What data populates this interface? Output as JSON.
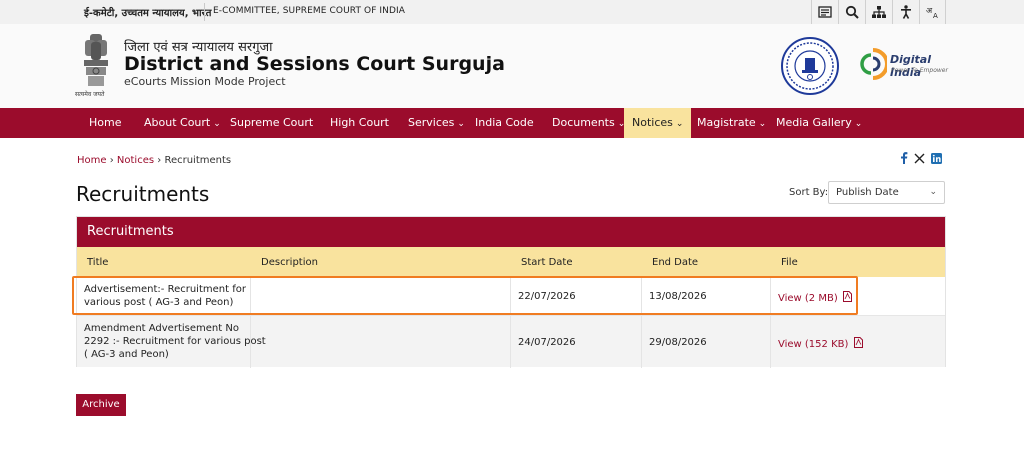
{
  "topbar": {
    "gov_label": "ई-कमेटी, उच्चतम न्यायालय, भारत",
    "ecommittee_label": "E-COMMITTEE, SUPREME COURT OF INDIA",
    "tools": [
      "sitemap-icon",
      "search-icon",
      "hierarchy-icon",
      "accessibility-icon",
      "language-icon"
    ]
  },
  "header": {
    "emblem_motto": "सत्यमेव जयते",
    "hindi_title": "जिला एवं सत्र न्यायालय सरगुजा",
    "title": "District and Sessions Court Surguja",
    "subtitle": "eCourts Mission Mode Project",
    "digital_india": "Digital India",
    "digital_india_tagline": "Power To Empower"
  },
  "nav": {
    "items": [
      {
        "label": "Home",
        "dropdown": false
      },
      {
        "label": "About Court",
        "dropdown": true
      },
      {
        "label": "Supreme Court",
        "dropdown": false
      },
      {
        "label": "High Court",
        "dropdown": false
      },
      {
        "label": "Services",
        "dropdown": true
      },
      {
        "label": "India Code",
        "dropdown": false
      },
      {
        "label": "Documents",
        "dropdown": true
      },
      {
        "label": "Notices",
        "dropdown": true,
        "active": true
      },
      {
        "label": "Magistrate",
        "dropdown": true
      },
      {
        "label": "Media Gallery",
        "dropdown": true
      }
    ]
  },
  "breadcrumb": {
    "home": "Home",
    "notices": "Notices",
    "current": "Recruitments",
    "sep": "›"
  },
  "page": {
    "title": "Recruitments",
    "sort_label": "Sort By:",
    "sort_value": "Publish Date"
  },
  "table": {
    "panel_title": "Recruitments",
    "columns": [
      "Title",
      "Description",
      "Start Date",
      "End Date",
      "File"
    ],
    "rows": [
      {
        "title_line1": "Advertisement:- Recruitment for",
        "title_line2": "various post ( AG-3 and Peon)",
        "title_line3": "",
        "description": "",
        "start": "22/07/2026",
        "end": "13/08/2026",
        "file": "View (2 MB)"
      },
      {
        "title_line1": "Amendment Advertisement No",
        "title_line2": "2292 :- Recruitment for various post",
        "title_line3": "( AG-3 and Peon)",
        "description": "",
        "start": "24/07/2026",
        "end": "29/08/2026",
        "file": "View (152 KB)"
      }
    ]
  },
  "archive_label": "Archive",
  "colors": {
    "brand": "#9b0c2c",
    "accent": "#f9e39e",
    "highlight": "#f07c22"
  }
}
